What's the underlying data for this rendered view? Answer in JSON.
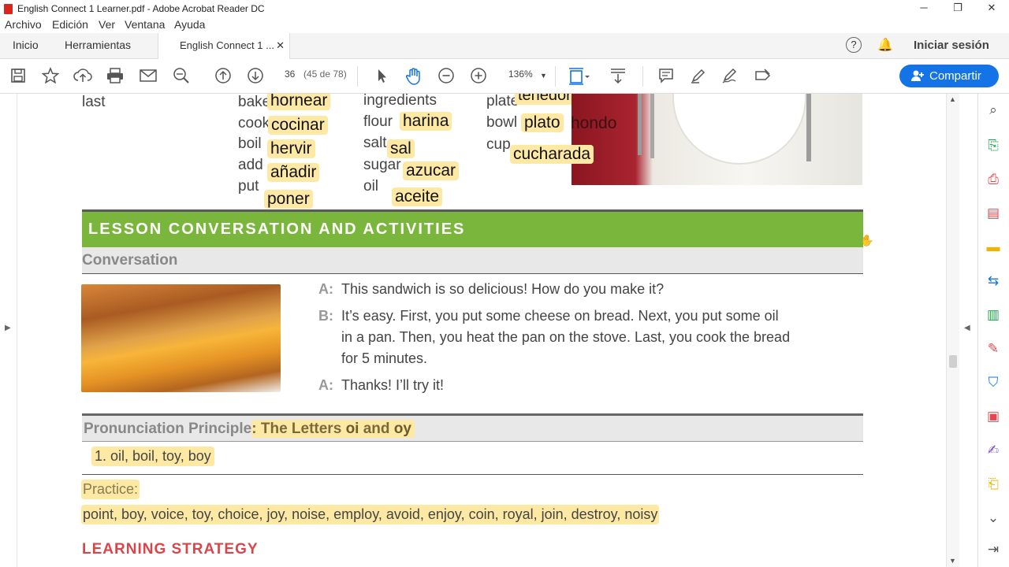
{
  "window": {
    "title": "English Connect 1 Learner.pdf - Adobe Acrobat Reader DC",
    "minimize": "─",
    "restore": "❐",
    "close": "✕"
  },
  "menu": [
    "Archivo",
    "Edición",
    "Ver",
    "Ventana",
    "Ayuda"
  ],
  "tabs": {
    "home": "Inicio",
    "tools": "Herramientas",
    "doc": "English Connect 1 ...",
    "close": "✕",
    "help": "?",
    "signin": "Iniciar sesión"
  },
  "toolbar": {
    "page_current": "36",
    "page_info": "(45 de 78)",
    "zoom": "136%",
    "share": "Compartir"
  },
  "vocab": {
    "col1": [
      "last"
    ],
    "col2": [
      {
        "en": "bake",
        "es": "hornear"
      },
      {
        "en": "cook",
        "es": "cocinar"
      },
      {
        "en": "boil",
        "es": "hervir"
      },
      {
        "en": "add",
        "es": "añadir"
      },
      {
        "en": "put",
        "es": "poner"
      }
    ],
    "col3": [
      {
        "en": "ingredients",
        "es": ""
      },
      {
        "en": "flour",
        "es": "harina"
      },
      {
        "en": "salt",
        "es": "sal"
      },
      {
        "en": "sugar",
        "es": "azucar"
      },
      {
        "en": "oil",
        "es": "aceite"
      }
    ],
    "col4": [
      {
        "en": "plate",
        "es": "tenedor"
      },
      {
        "en": "bowl",
        "es": "plato"
      },
      {
        "en": "cup",
        "es": "cucharada"
      }
    ],
    "extra": "hondo"
  },
  "banner": "LESSON CONVERSATION AND ACTIVITIES",
  "conversation": {
    "heading": "Conversation",
    "lines": [
      {
        "speaker": "A:",
        "text": [
          "This sandwich is so delicious! How do you make it?"
        ]
      },
      {
        "speaker": "B:",
        "text": [
          "It’s easy. First, you put some cheese on bread. Next, you put some oil",
          "in a pan. Then, you heat the pan on the stove. Last, you cook the bread",
          "for 5 minutes."
        ]
      },
      {
        "speaker": "A:",
        "text": [
          "Thanks! I’ll try it!"
        ]
      }
    ]
  },
  "pronunciation": {
    "heading_a": "Pronunciation Principle",
    "heading_b": ": The Letters ",
    "oi": "oi",
    "and": " and ",
    "oy": "oy",
    "item": "1.  oil, boil, toy, boy"
  },
  "practice": {
    "label": "Practice:",
    "words": "point, boy, voice, toy, choice, joy, noise, employ, avoid, enjoy, coin, royal, join, destroy, noisy"
  },
  "strategy": "LEARNING STRATEGY",
  "colors": {
    "accent": "#1473e6",
    "banner": "#7bb63c",
    "highlight": "#fde9a4",
    "strategy": "#d9464a"
  }
}
